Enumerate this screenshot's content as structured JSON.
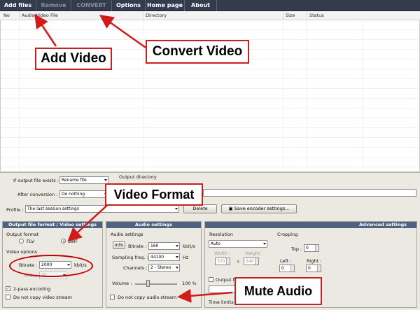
{
  "menu": {
    "add_files": "Add files",
    "remove": "Remove",
    "convert": "CONVERT",
    "options": "Options",
    "home_page": "Home page",
    "about": "About"
  },
  "table": {
    "columns": [
      "No",
      "Audio/Video File",
      "Directory",
      "Size",
      "Status"
    ]
  },
  "output": {
    "if_exists_label": "If output file exists :",
    "if_exists_value": "Rename file",
    "after_conversion_label": "After conversion :",
    "after_conversion_value": "Do nothing",
    "output_directory_label": "Output directory",
    "profile_label": "Profile :",
    "profile_value": "The last session settings",
    "delete_button": "Delete",
    "save_button": "Save encoder settings..."
  },
  "video_panel": {
    "title": "Output file format / Video settings",
    "output_format_label": "Output format",
    "format_flv": "FLV",
    "format_swf": "SWF",
    "selected_format": "SWF",
    "video_options_label": "Video options",
    "bitrate_label": "Bitrate :",
    "bitrate_value": "2000",
    "bitrate_unit": "kbit/s",
    "fps_label": "FPS :",
    "fps_value": "30",
    "two_pass_label": "2-pass encoding",
    "two_pass_checked": true,
    "no_video_label": "Do not copy video stream",
    "no_video_checked": false
  },
  "audio_panel": {
    "title": "Audio settings",
    "section_label": "Audio settings",
    "info_button": "Info",
    "bitrate_label": "Bitrate :",
    "bitrate_value": "160",
    "bitrate_unit": "kbit/s",
    "sampling_label": "Sampling freq. :",
    "sampling_value": "44100",
    "sampling_unit": "Hz",
    "channels_label": "Channels :",
    "channels_value": "2 - Stereo",
    "volume_label": "Volume :",
    "volume_value": "100 %",
    "no_audio_label": "Do not copy audio stream",
    "no_audio_checked": false
  },
  "advanced_panel": {
    "title": "Advanced settings",
    "resolution_label": "Resolution",
    "resolution_value": "Auto",
    "width_label": "Width :",
    "width_value": "320",
    "height_label": "Height :",
    "height_value": "240",
    "x_sep": "X",
    "cropping_label": "Cropping",
    "top_label": "Top :",
    "top_value": "0",
    "left_label": "Left :",
    "left_value": "0",
    "right_label": "Right :",
    "right_value": "0",
    "output_frame_label": "Output fr",
    "time_limits_label": "Time limits"
  },
  "callouts": {
    "add_video": "Add Video",
    "convert_video": "Convert Video",
    "video_format": "Video Format",
    "mute_audio": "Mute Audio"
  },
  "colors": {
    "menubar": "#333c4d",
    "group_header": "#4f6281",
    "callout_border": "#c62020",
    "panel_bg": "#ece9e2"
  }
}
